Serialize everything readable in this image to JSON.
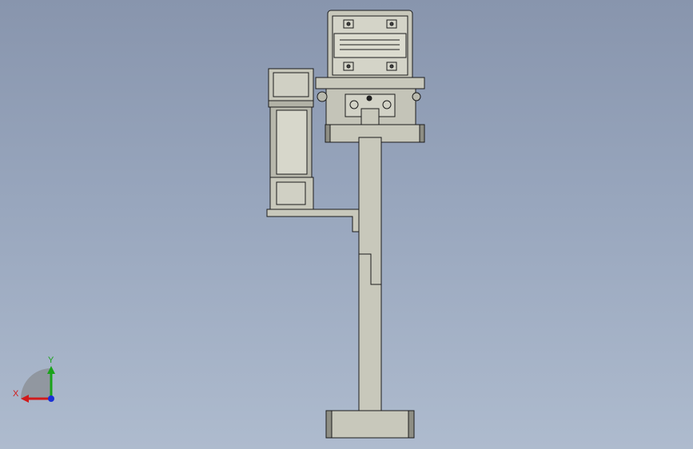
{
  "viewport": {
    "background_top": "#8895ad",
    "background_bottom": "#aebbce"
  },
  "model": {
    "part_fill": "#c8c8bb",
    "part_fill_light": "#d9d9cd",
    "part_shade": "#8e8e84",
    "edge_color": "#1c1c1c"
  },
  "triad": {
    "x_label": "X",
    "y_label": "Y",
    "x_color": "#d11a1a",
    "y_color": "#1aa31a",
    "z_color": "#1a2fd6"
  }
}
